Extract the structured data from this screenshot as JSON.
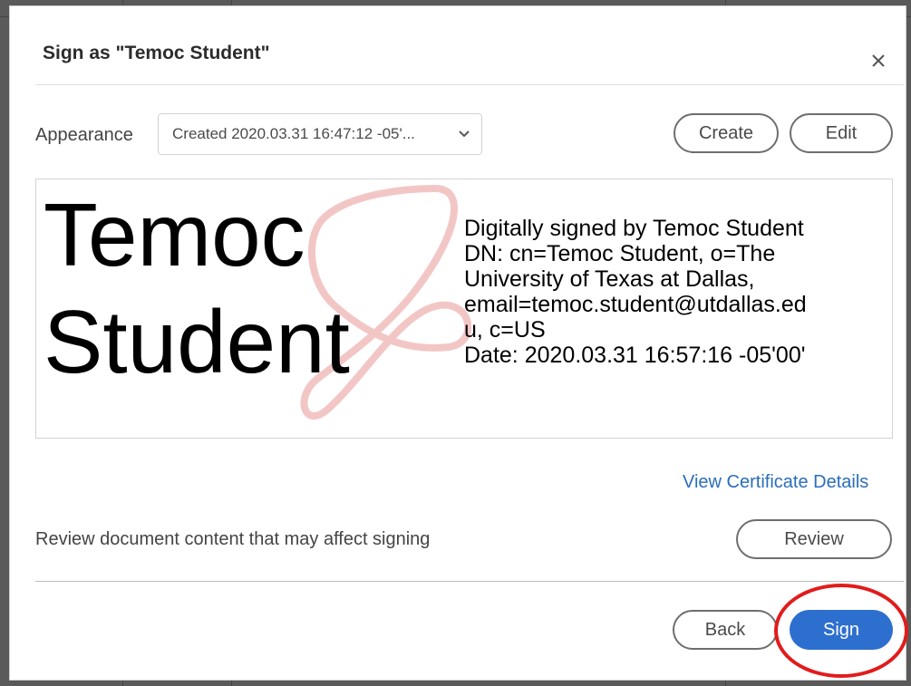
{
  "dialog": {
    "title": "Sign as \"Temoc Student\"",
    "close_icon": "close-icon"
  },
  "appearance": {
    "label": "Appearance",
    "selected": "Created 2020.03.31 16:47:12 -05'...",
    "chevron_icon": "chevron-down-icon",
    "create_label": "Create",
    "edit_label": "Edit"
  },
  "signature_preview": {
    "name_lines": [
      "Temoc",
      "Student"
    ],
    "detail_lines": [
      "Digitally signed by Temoc Student",
      "DN: cn=Temoc Student, o=The",
      "University of Texas at Dallas,",
      "email=temoc.student@utdallas.ed",
      "u, c=US",
      "Date: 2020.03.31 16:57:16 -05'00'"
    ],
    "watermark_icon": "acrobat-logo-icon"
  },
  "certificate": {
    "link_label": "View Certificate Details"
  },
  "review": {
    "text": "Review document content that may affect signing",
    "button_label": "Review"
  },
  "footer": {
    "back_label": "Back",
    "sign_label": "Sign"
  },
  "colors": {
    "accent": "#2d6fce",
    "link": "#2a6ebb",
    "highlight": "#e21b1b",
    "watermark": "#f3c6c6"
  }
}
